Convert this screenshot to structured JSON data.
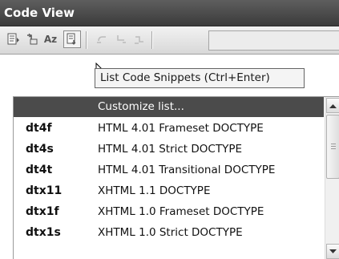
{
  "panel": {
    "title": "Code View"
  },
  "toolbar": {
    "buttons": [
      {
        "icon": "format-code-icon"
      },
      {
        "icon": "select-parent-tag-icon"
      },
      {
        "icon": "spelling-az-icon",
        "label": "Aᴢ"
      },
      {
        "icon": "list-snippets-icon"
      },
      {
        "icon": "undo-icon"
      },
      {
        "icon": "redo-icon"
      },
      {
        "icon": "comment-icon"
      }
    ]
  },
  "tooltip": {
    "text": "List Code Snippets (Ctrl+Enter)"
  },
  "snippets": {
    "customize_label": "Customize list...",
    "items": [
      {
        "key": "dt4f",
        "description": "HTML 4.01 Frameset DOCTYPE"
      },
      {
        "key": "dt4s",
        "description": "HTML 4.01 Strict DOCTYPE"
      },
      {
        "key": "dt4t",
        "description": "HTML 4.01 Transitional DOCTYPE"
      },
      {
        "key": "dtx11",
        "description": "XHTML 1.1 DOCTYPE"
      },
      {
        "key": "dtx1f",
        "description": "XHTML 1.0 Frameset DOCTYPE"
      },
      {
        "key": "dtx1s",
        "description": "XHTML 1.0 Strict DOCTYPE"
      }
    ]
  },
  "colors": {
    "title_bar": "#4a4a4a",
    "header_row": "#4b4b4b",
    "tooltip_bg": "#f4f4f4"
  }
}
